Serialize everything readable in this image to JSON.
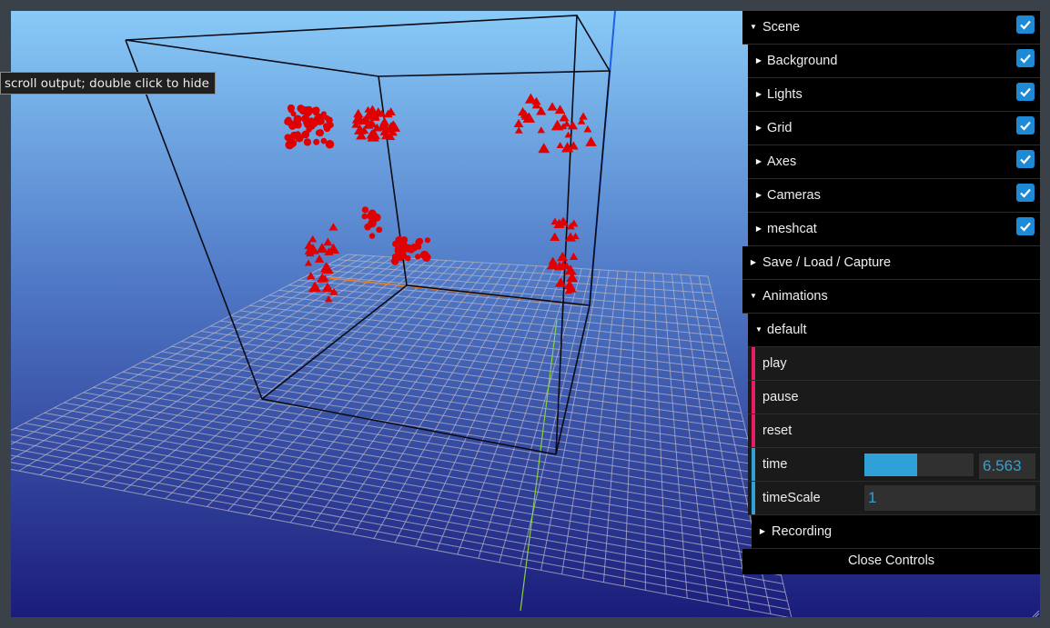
{
  "tooltip": "scroll output; double click to hide",
  "controls": {
    "scene": {
      "label": "Scene",
      "checked": true
    },
    "scene_children": [
      {
        "label": "Background",
        "checked": true
      },
      {
        "label": "Lights",
        "checked": true
      },
      {
        "label": "Grid",
        "checked": true
      },
      {
        "label": "Axes",
        "checked": true
      },
      {
        "label": "Cameras",
        "checked": true
      },
      {
        "label": "meshcat",
        "checked": true
      }
    ],
    "save_load": {
      "label": "Save / Load / Capture"
    },
    "animations": {
      "label": "Animations"
    },
    "default": {
      "label": "default"
    },
    "play": {
      "label": "play"
    },
    "pause": {
      "label": "pause"
    },
    "reset": {
      "label": "reset"
    },
    "time": {
      "label": "time",
      "value": "6.563",
      "slider_fraction": 0.48
    },
    "timescale": {
      "label": "timeScale",
      "value": "1"
    },
    "recording": {
      "label": "Recording"
    },
    "close": {
      "label": "Close Controls"
    }
  },
  "colors": {
    "sky_top": "#87c9f6",
    "sky_bottom": "#1a1b78",
    "accent": "#2fa1d6",
    "button_marker": "#e61d5f",
    "objects": "#e00000"
  }
}
